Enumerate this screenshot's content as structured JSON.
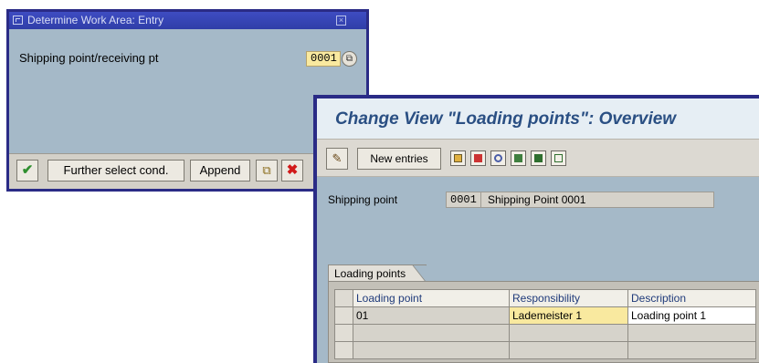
{
  "dialog": {
    "title": "Determine Work Area: Entry",
    "field_label": "Shipping point/receiving pt",
    "field_value": "0001",
    "buttons": {
      "further_select": "Further select cond.",
      "append": "Append"
    }
  },
  "window": {
    "title": "Change View \"Loading points\": Overview",
    "new_entries_label": "New entries",
    "shipping_point_label": "Shipping point",
    "shipping_point_code": "0001",
    "shipping_point_desc": "Shipping Point 0001",
    "tab_label": "Loading points",
    "table": {
      "headers": [
        "Loading point",
        "Responsibility",
        "Description"
      ],
      "rows": [
        [
          "01",
          "Lademeister 1",
          "Loading point 1"
        ],
        [
          "",
          "",
          ""
        ],
        [
          "",
          "",
          ""
        ]
      ]
    }
  },
  "colors": {
    "dialog_border": "#2a2b86",
    "screen_bg": "#a5b9c8",
    "input_yellow": "#f9e99f",
    "title_blue": "#2a4f83"
  }
}
